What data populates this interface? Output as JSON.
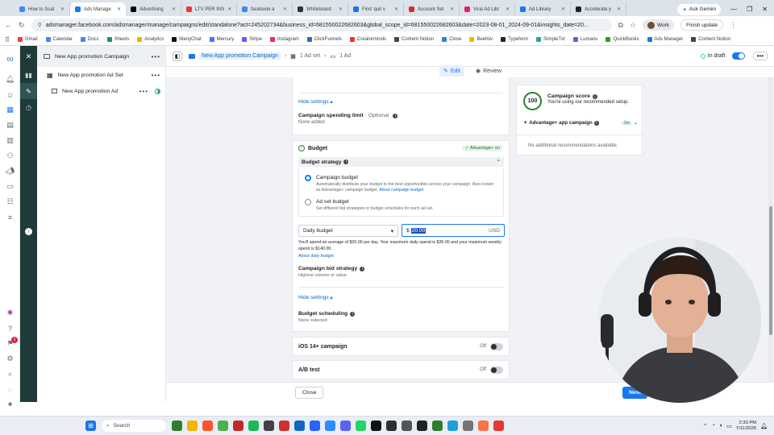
{
  "browser": {
    "tabs": [
      {
        "label": "How to Scal",
        "color": "#4285f4"
      },
      {
        "label": "Ads Manage",
        "color": "#1877f2",
        "active": true
      },
      {
        "label": "Advertising",
        "color": "#000000"
      },
      {
        "label": "LTV PER INS",
        "color": "#e53935"
      },
      {
        "label": "facebook a",
        "color": "#4285f4"
      },
      {
        "label": "Whiteboard",
        "color": "#333333"
      },
      {
        "label": "Find 'quit v",
        "color": "#1a73e8"
      },
      {
        "label": "Account Set",
        "color": "#d32f2f"
      },
      {
        "label": "Viral Ad Libr",
        "color": "#e91e63"
      },
      {
        "label": "Ad Library",
        "color": "#1877f2"
      },
      {
        "label": "Accelerate y",
        "color": "#202124"
      }
    ],
    "ask_gemini": "Ask Gemini",
    "url": "adsmanager.facebook.com/adsmanager/manage/campaigns/edit/standalone?act=245202734&business_id=681550022682603&global_scope_id=681550022682603&date=2023-08-01_2024-09-01&insights_date=20...",
    "profile": "Work",
    "finish_update": "Finish update",
    "bookmarks": [
      {
        "label": "Gmail",
        "color": "#ea4335"
      },
      {
        "label": "Calendar",
        "color": "#4285f4"
      },
      {
        "label": "Docs",
        "color": "#4285f4"
      },
      {
        "label": "Sheets",
        "color": "#0f9d58"
      },
      {
        "label": "Analytics",
        "color": "#f9ab00"
      },
      {
        "label": "ManyChat",
        "color": "#111111"
      },
      {
        "label": "Mercury",
        "color": "#5b6cff"
      },
      {
        "label": "Stripe",
        "color": "#635bff"
      },
      {
        "label": "Instagram",
        "color": "#e1306c"
      },
      {
        "label": "ClickFunnels",
        "color": "#2b6cb0"
      },
      {
        "label": "Creatorminds",
        "color": "#e53935"
      },
      {
        "label": "Content Notion",
        "color": "#444444"
      },
      {
        "label": "Close",
        "color": "#1e88e5"
      },
      {
        "label": "Beehiiv",
        "color": "#f4b400"
      },
      {
        "label": "Typeform",
        "color": "#262627"
      },
      {
        "label": "SimpleTxt",
        "color": "#26a69a"
      },
      {
        "label": "Lumanu",
        "color": "#7e57c2"
      },
      {
        "label": "QuickBooks",
        "color": "#2ca01c"
      },
      {
        "label": "Ads Manager",
        "color": "#1877f2"
      },
      {
        "label": "Content Notion",
        "color": "#444444"
      }
    ]
  },
  "tree": {
    "campaign": "New App promotion Campaign",
    "adset": "New App promotion Ad Set",
    "ad": "New App promotion Ad"
  },
  "breadcrumb": {
    "campaign": "New App promotion Campaign",
    "adset": "1 Ad set",
    "ad": "1 Ad"
  },
  "status": {
    "label": "In draft"
  },
  "mode": {
    "edit": "Edit",
    "review": "Review"
  },
  "form": {
    "hide_settings_1": "Hide settings",
    "spending_limit_label": "Campaign spending limit",
    "spending_limit_optional": " · Optional",
    "spending_limit_value": "None added",
    "budget_heading": "Budget",
    "advantage_on_badge": "Advantage+ on",
    "budget_strategy_label": "Budget strategy",
    "campaign_budget_title": "Campaign budget",
    "campaign_budget_desc": "Automatically distribute your budget to the best opportunities across your campaign. Also known as Advantage+ campaign budget.",
    "campaign_budget_link": "About campaign budget",
    "adset_budget_title": "Ad set budget",
    "adset_budget_desc": "Set different bid strategies or budget schedules for each ad set.",
    "budget_type": "Daily budget",
    "currency_symbol": "$",
    "budget_amount": "20.00",
    "currency_code": "USD",
    "spend_note": "You'll spend an average of $20.00 per day. Your maximum daily spend is $35.00 and your maximum weekly spend is $140.00.",
    "about_daily_budget": "About daily budget",
    "bid_strategy_label": "Campaign bid strategy",
    "bid_strategy_value": "Highest volume or value",
    "hide_settings_2": "Hide settings",
    "scheduling_label": "Budget scheduling",
    "scheduling_value": "None selected",
    "ios_label": "iOS 14+ campaign",
    "ios_state": "Off",
    "ab_label": "A/B test",
    "ab_state": "Off"
  },
  "score": {
    "value": "100",
    "title": "Campaign score",
    "subtitle": "You're using our recommended setup.",
    "advantage_label": "Advantage+ app campaign",
    "advantage_state": "On",
    "no_recs": "No additional recommendations available."
  },
  "footer": {
    "close": "Close",
    "next": "Next"
  },
  "taskbar": {
    "search": "Search",
    "time": "2:33 PM",
    "date": "7/11/2026"
  },
  "notification_badge": "1"
}
